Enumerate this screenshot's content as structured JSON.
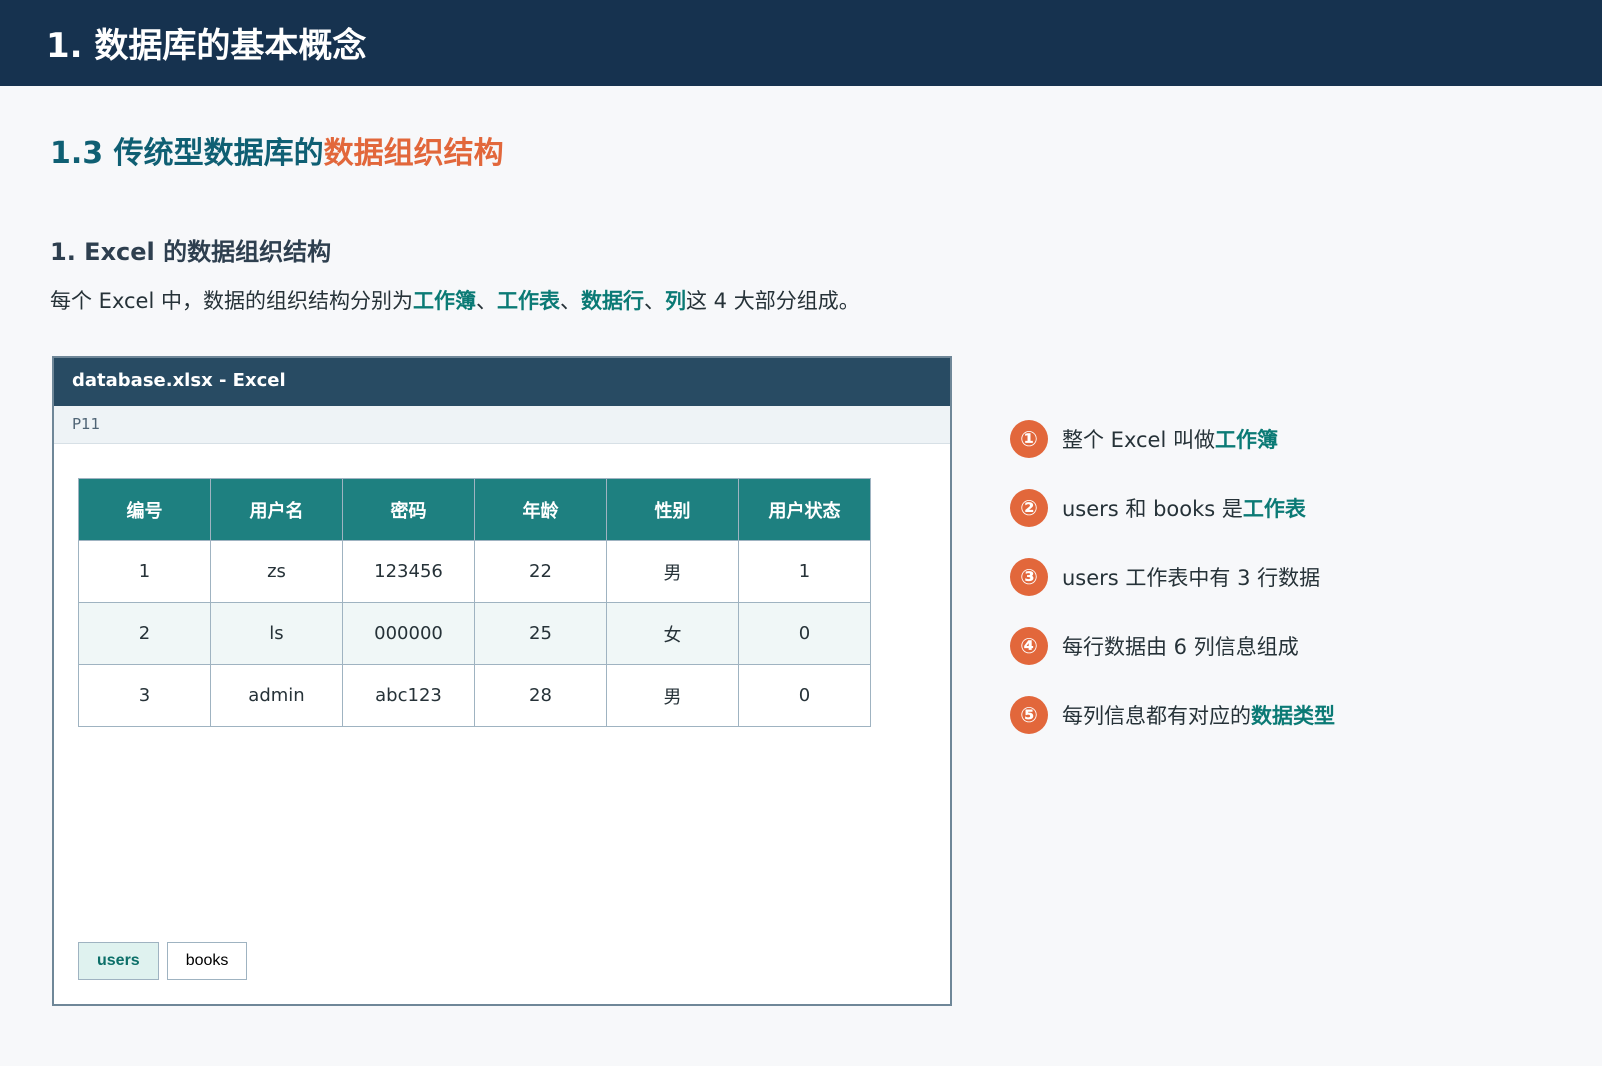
{
  "title": "1. 数据库的基本概念",
  "subtitle_prefix": "1.3 传统型数据库的",
  "subtitle_focus": "数据组织结构",
  "section": "1. Excel 的数据组织结构",
  "lead": {
    "before": "每个 Excel 中，数据的组织结构分别为",
    "workbook": "工作簿",
    "sep1": "、",
    "worksheet": "工作表",
    "sep2": "、",
    "row": "数据行",
    "sep3": "、",
    "column": "列",
    "after": "这 4 大部分组成。"
  },
  "sheet": {
    "file": "database.xlsx - Excel",
    "formula_cell": "P11",
    "tabs": [
      "users",
      "books"
    ]
  },
  "table": {
    "headers": [
      "编号",
      "用户名",
      "密码",
      "年龄",
      "性别",
      "用户状态"
    ],
    "rows": [
      [
        "1",
        "zs",
        "123456",
        "22",
        "男",
        "1"
      ],
      [
        "2",
        "ls",
        "000000",
        "25",
        "女",
        "0"
      ],
      [
        "3",
        "admin",
        "abc123",
        "28",
        "男",
        "0"
      ]
    ]
  },
  "notes": [
    {
      "num": "①",
      "before": "整个 Excel 叫做",
      "key": "工作簿"
    },
    {
      "num": "②",
      "before": "users 和 books 是",
      "key": "工作表"
    },
    {
      "num": "③",
      "before": "users 工作表中有 3 行数据",
      "key": ""
    },
    {
      "num": "④",
      "before": "每行数据由 6 列信息组成",
      "key": ""
    },
    {
      "num": "⑤",
      "before": "每列信息都有对应的",
      "key": "数据类型"
    }
  ]
}
